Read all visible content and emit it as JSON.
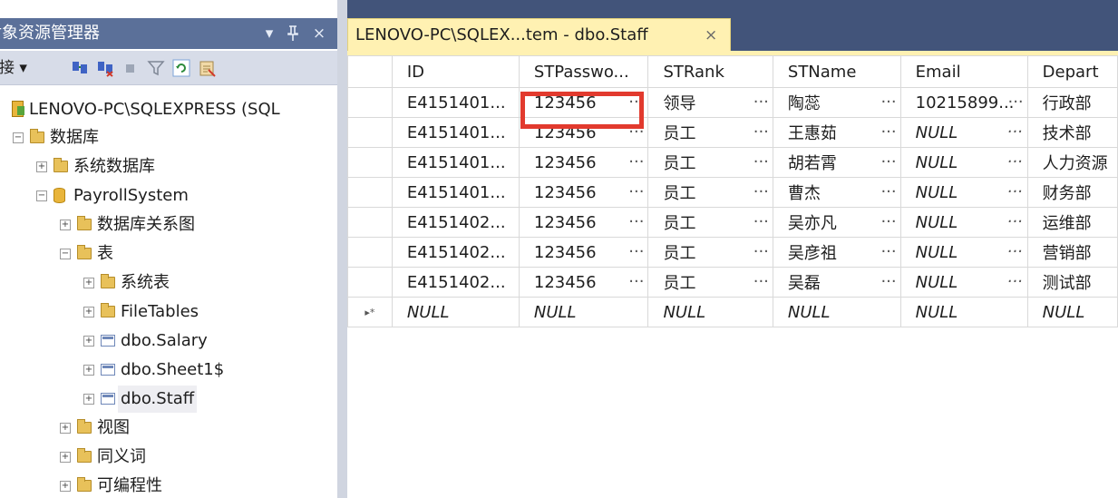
{
  "object_explorer": {
    "title": "对象资源管理器",
    "pin_glyph": "▾",
    "autohide_glyph": "ф",
    "close_glyph": "×",
    "toolbar": {
      "connect_label": "连接 ▾"
    },
    "tree": [
      {
        "label": "LENOVO-PC\\SQLEXPRESS (SQL",
        "icon": "server-icon",
        "expander": "⊟"
      },
      {
        "label": "数据库",
        "icon": "folder-icon",
        "expander": "−"
      },
      {
        "label": "系统数据库",
        "icon": "folder-icon",
        "expander": "+"
      },
      {
        "label": "PayrollSystem",
        "icon": "database-icon",
        "expander": "−"
      },
      {
        "label": "数据库关系图",
        "icon": "folder-icon",
        "expander": "+"
      },
      {
        "label": "表",
        "icon": "folder-icon",
        "expander": "−"
      },
      {
        "label": "系统表",
        "icon": "folder-icon",
        "expander": "+"
      },
      {
        "label": "FileTables",
        "icon": "folder-icon",
        "expander": "+"
      },
      {
        "label": "dbo.Salary",
        "icon": "table-icon",
        "expander": "+"
      },
      {
        "label": "dbo.Sheet1$",
        "icon": "table-icon",
        "expander": "+"
      },
      {
        "label": "dbo.Staff",
        "icon": "table-icon",
        "expander": "+"
      },
      {
        "label": "视图",
        "icon": "folder-icon",
        "expander": "+"
      },
      {
        "label": "同义词",
        "icon": "folder-icon",
        "expander": "+"
      },
      {
        "label": "可编程性",
        "icon": "folder-icon",
        "expander": "+"
      }
    ]
  },
  "document": {
    "tab_title": "LENOVO-PC\\SQLEX...tem - dbo.Staff",
    "tab_close": "×",
    "grid": {
      "columns": [
        "ID",
        "STPasswo...",
        "STRank",
        "STName",
        "Email",
        "Depart"
      ],
      "rows": [
        {
          "ID": "E4151401...",
          "STPassword": "123456",
          "STRank": "领导",
          "STName": "陶蕊",
          "Email": "10215899...",
          "Depart": "行政部"
        },
        {
          "ID": "E4151401...",
          "STPassword": "123456",
          "STRank": "员工",
          "STName": "王惠茹",
          "Email": "NULL",
          "Depart": "技术部"
        },
        {
          "ID": "E4151401...",
          "STPassword": "123456",
          "STRank": "员工",
          "STName": "胡若霄",
          "Email": "NULL",
          "Depart": "人力资源"
        },
        {
          "ID": "E4151401...",
          "STPassword": "123456",
          "STRank": "员工",
          "STName": "曹杰",
          "Email": "NULL",
          "Depart": "财务部"
        },
        {
          "ID": "E4151402...",
          "STPassword": "123456",
          "STRank": "员工",
          "STName": "吴亦凡",
          "Email": "NULL",
          "Depart": "运维部"
        },
        {
          "ID": "E4151402...",
          "STPassword": "123456",
          "STRank": "员工",
          "STName": "吴彦祖",
          "Email": "NULL",
          "Depart": "营销部"
        },
        {
          "ID": "E4151402...",
          "STPassword": "123456",
          "STRank": "员工",
          "STName": "吴磊",
          "Email": "NULL",
          "Depart": "测试部"
        }
      ],
      "new_row": {
        "marker": "▸*",
        "value": "NULL"
      },
      "ellipsis": "..."
    }
  },
  "colors": {
    "title_bar": "#5b7099",
    "tab_active": "#fff1b2",
    "highlight": "#e23a2e"
  }
}
